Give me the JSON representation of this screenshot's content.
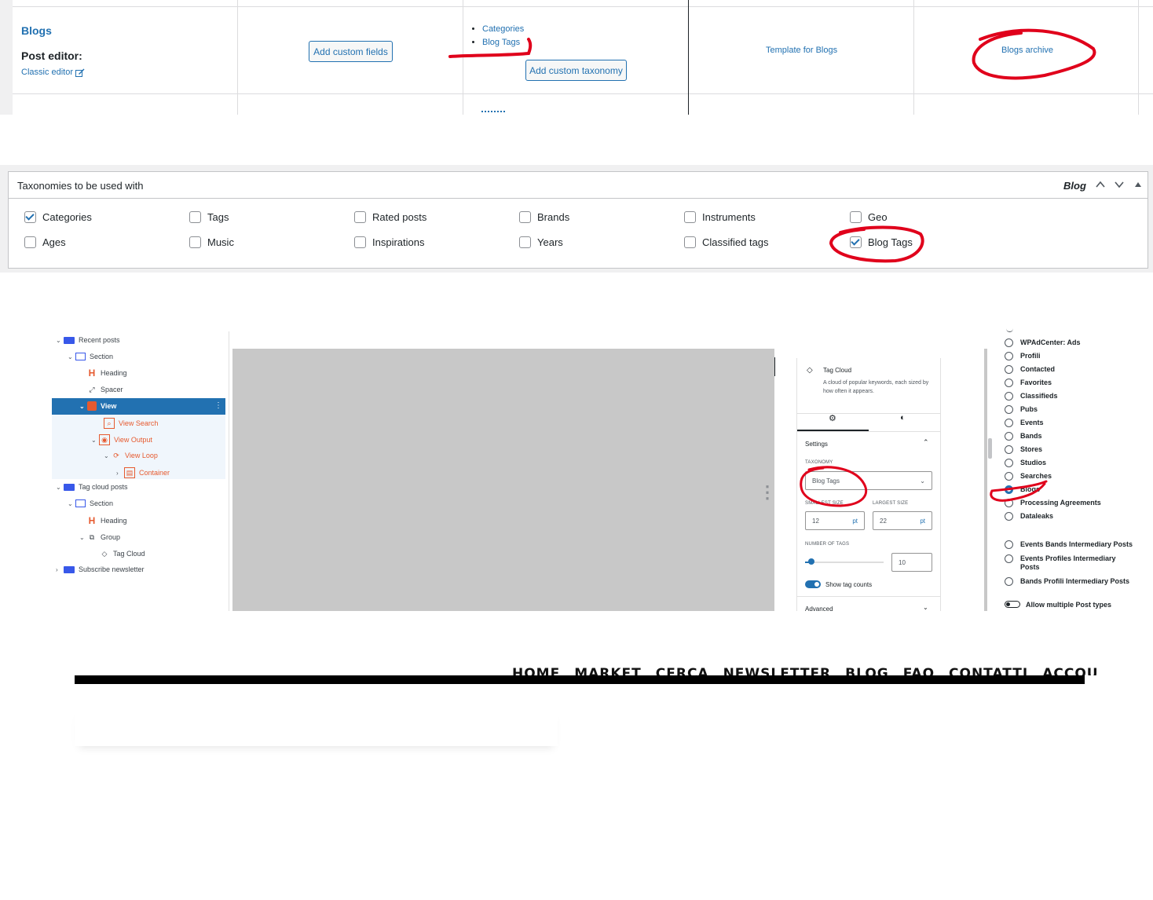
{
  "posttype_row": {
    "name": "Blogs",
    "post_editor_label": "Post editor:",
    "editor_link": "Classic editor",
    "add_fields_button": "Add custom fields",
    "taxonomies": [
      "Categories",
      "Blog Tags"
    ],
    "add_taxonomy_button": "Add custom taxonomy",
    "template_link": "Template for Blogs",
    "archive_link": "Blogs archive"
  },
  "taxonomies_box": {
    "title": "Taxonomies to be used with",
    "post_type": "Blog",
    "options": [
      {
        "label": "Categories",
        "checked": true
      },
      {
        "label": "Tags",
        "checked": false
      },
      {
        "label": "Rated posts",
        "checked": false
      },
      {
        "label": "Brands",
        "checked": false
      },
      {
        "label": "Instruments",
        "checked": false
      },
      {
        "label": "Geo",
        "checked": false
      },
      {
        "label": "Ages",
        "checked": false
      },
      {
        "label": "Music",
        "checked": false
      },
      {
        "label": "Inspirations",
        "checked": false
      },
      {
        "label": "Years",
        "checked": false
      },
      {
        "label": "Classified tags",
        "checked": false
      },
      {
        "label": "Blog Tags",
        "checked": true
      }
    ]
  },
  "block_tree": [
    "Recent posts",
    "Section",
    "Heading",
    "Spacer",
    "View",
    "View Search",
    "View Output",
    "View Loop",
    "Container",
    "Tag cloud posts",
    "Section",
    "Heading",
    "Group",
    "Tag Cloud",
    "Subscribe newsletter"
  ],
  "tag_cloud_panel": {
    "block_name": "Tag Cloud",
    "description": "A cloud of popular keywords, each sized by how often it appears.",
    "settings_label": "Settings",
    "taxonomy_label": "TAXONOMY",
    "taxonomy_value": "Blog Tags",
    "smallest_label": "SMALLEST SIZE",
    "smallest_value": "12",
    "largest_label": "LARGEST SIZE",
    "largest_value": "22",
    "unit": "pt",
    "number_label": "NUMBER OF TAGS",
    "number_value": "10",
    "show_counts_label": "Show tag counts",
    "advanced_label": "Advanced"
  },
  "post_types_list": {
    "options": [
      {
        "label": "WPAdCenter: Ads",
        "selected": false
      },
      {
        "label": "Profili",
        "selected": false
      },
      {
        "label": "Contacted",
        "selected": false
      },
      {
        "label": "Favorites",
        "selected": false
      },
      {
        "label": "Classifieds",
        "selected": false
      },
      {
        "label": "Pubs",
        "selected": false
      },
      {
        "label": "Events",
        "selected": false
      },
      {
        "label": "Bands",
        "selected": false
      },
      {
        "label": "Stores",
        "selected": false
      },
      {
        "label": "Studios",
        "selected": false
      },
      {
        "label": "Searches",
        "selected": false
      },
      {
        "label": "Blogs",
        "selected": true
      },
      {
        "label": "Processing Agreements",
        "selected": false
      },
      {
        "label": "Dataleaks",
        "selected": false
      },
      {
        "label": "Events Bands Intermediary Posts",
        "selected": false
      },
      {
        "label": "Events Profiles Intermediary Posts",
        "selected": false
      },
      {
        "label": "Bands Profili Intermediary Posts",
        "selected": false
      }
    ],
    "allow_multiple_label": "Allow multiple Post types"
  },
  "site_nav": {
    "items": [
      "HOME",
      "MARKET",
      "CERCA",
      "NEWSLETTER",
      "BLOG",
      "FAQ",
      "CONTATTI",
      "ACCOUNT"
    ]
  },
  "colors": {
    "link": "#2271b1",
    "annotation": "#e0001b",
    "selected_row": "#2271b1",
    "canvas_gray": "#c8c8c8"
  }
}
